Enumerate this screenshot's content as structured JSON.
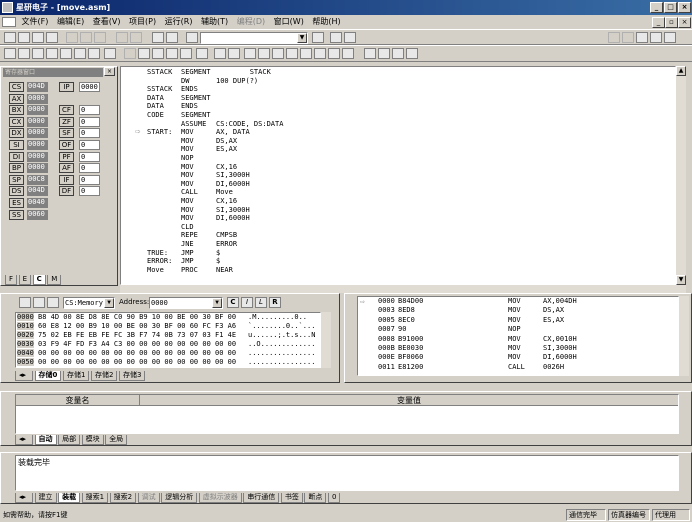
{
  "window": {
    "title": "星研电子 - [move.asm]"
  },
  "menu": {
    "items": [
      "文件(F)",
      "编辑(E)",
      "查看(V)",
      "项目(P)",
      "运行(R)",
      "辅助(T)",
      "编程(D)",
      "窗口(W)",
      "帮助(H)"
    ]
  },
  "toolbar": {
    "target_select": "",
    "memory_select": "CS:Memory",
    "address_label": "Address:",
    "address_value": "0000",
    "btn_c": "C",
    "btn_i": "I",
    "btn_l": "L",
    "btn_r": "R"
  },
  "registers": {
    "title": "寄存器窗口",
    "rows": [
      {
        "l": "CS",
        "v": "004D",
        "l2": "IP",
        "v2": "0000"
      },
      {
        "l": "AX",
        "v": "0000"
      },
      {
        "l": "BX",
        "v": "0000",
        "l2": "CF",
        "v2": "0"
      },
      {
        "l": "CX",
        "v": "0000",
        "l2": "ZF",
        "v2": "0"
      },
      {
        "l": "DX",
        "v": "0000",
        "l2": "SF",
        "v2": "0"
      },
      {
        "l": "SI",
        "v": "0000",
        "l2": "OF",
        "v2": "0"
      },
      {
        "l": "DI",
        "v": "0000",
        "l2": "PF",
        "v2": "0"
      },
      {
        "l": "BP",
        "v": "0000",
        "l2": "AF",
        "v2": "0"
      },
      {
        "l": "SP",
        "v": "00C8",
        "l2": "IF",
        "v2": "0"
      },
      {
        "l": "DS",
        "v": "004D",
        "l2": "DF",
        "v2": "0"
      },
      {
        "l": "ES",
        "v": "0040"
      },
      {
        "l": "SS",
        "v": "0060"
      }
    ],
    "tabs": [
      "F",
      "E",
      "C",
      "M"
    ]
  },
  "source": {
    "lines": [
      {
        "a": "SSTACK",
        "b": "SEGMENT",
        "c": "        STACK"
      },
      {
        "a": "",
        "b": "DW",
        "c": "100 DUP(?)"
      },
      {
        "a": "SSTACK",
        "b": "ENDS",
        "c": ""
      },
      {
        "a": "DATA",
        "b": "SEGMENT",
        "c": ""
      },
      {
        "a": "DATA",
        "b": "ENDS",
        "c": ""
      },
      {
        "a": "CODE",
        "b": "SEGMENT",
        "c": ""
      },
      {
        "a": "",
        "b": "ASSUME",
        "c": "CS:CODE, DS:DATA"
      },
      {
        "a": "START:",
        "b": "MOV",
        "c": "AX, DATA"
      },
      {
        "a": "",
        "b": "MOV",
        "c": "DS,AX"
      },
      {
        "a": "",
        "b": "MOV",
        "c": "ES,AX"
      },
      {
        "a": "",
        "b": "NOP",
        "c": ""
      },
      {
        "a": "",
        "b": "MOV",
        "c": "CX,16"
      },
      {
        "a": "",
        "b": "MOV",
        "c": "SI,3000H"
      },
      {
        "a": "",
        "b": "MOV",
        "c": "DI,6000H"
      },
      {
        "a": "",
        "b": "CALL",
        "c": "Move"
      },
      {
        "a": "",
        "b": "MOV",
        "c": "CX,16"
      },
      {
        "a": "",
        "b": "MOV",
        "c": "SI,3000H"
      },
      {
        "a": "",
        "b": "MOV",
        "c": "DI,6000H"
      },
      {
        "a": "",
        "b": "CLD",
        "c": ""
      },
      {
        "a": "",
        "b": "REPE",
        "c": "CMPSB"
      },
      {
        "a": "",
        "b": "JNE",
        "c": "ERROR"
      },
      {
        "a": "TRUE:",
        "b": "JMP",
        "c": "$"
      },
      {
        "a": "ERROR:",
        "b": "JMP",
        "c": "$"
      },
      {
        "a": "Move",
        "b": "PROC",
        "c": "NEAR"
      }
    ]
  },
  "memory": {
    "rows": [
      {
        "addr": "0000",
        "hex": "B8 4D 00 8E D8 8E C0 90 B9 10 00 BE 00 30 BF 00",
        "asc": ".M.........0.."
      },
      {
        "addr": "0010",
        "hex": "60 E8 12 00 B9 10 00 BE 00 30 BF 00 60 FC F3 A6",
        "asc": "`........0..`..."
      },
      {
        "addr": "0020",
        "hex": "75 02 EB FE EB FE FC 3B F7 74 0B 73 07 03 F1 4E",
        "asc": "u......;.t.s...N"
      },
      {
        "addr": "0030",
        "hex": "03 F9 4F FD F3 A4 C3 00 00 00 00 00 00 00 00 00",
        "asc": "..O............."
      },
      {
        "addr": "0040",
        "hex": "00 00 00 00 00 00 00 00 00 00 00 00 00 00 00 00",
        "asc": "................"
      },
      {
        "addr": "0050",
        "hex": "00 00 00 00 00 00 00 00 00 00 00 00 00 00 00 00",
        "asc": "................"
      }
    ],
    "tabs": [
      "存储0",
      "存储1",
      "存储2",
      "存储3"
    ]
  },
  "disasm": {
    "rows": [
      {
        "addr": "0000",
        "code": "B84D00",
        "op": "MOV",
        "arg": "AX,004DH"
      },
      {
        "addr": "0003",
        "code": "8ED8",
        "op": "MOV",
        "arg": "DS,AX"
      },
      {
        "addr": "0005",
        "code": "8EC0",
        "op": "MOV",
        "arg": "ES,AX"
      },
      {
        "addr": "0007",
        "code": "90",
        "op": "NOP",
        "arg": ""
      },
      {
        "addr": "0008",
        "code": "B91000",
        "op": "MOV",
        "arg": "CX,0010H"
      },
      {
        "addr": "000B",
        "code": "BE0030",
        "op": "MOV",
        "arg": "SI,3000H"
      },
      {
        "addr": "000E",
        "code": "BF0060",
        "op": "MOV",
        "arg": "DI,6000H"
      },
      {
        "addr": "0011",
        "code": "E81200",
        "op": "CALL",
        "arg": "0026H"
      }
    ]
  },
  "watch": {
    "col1": "变量名",
    "col2": "变量值",
    "tabs": [
      "自动",
      "局部",
      "模块",
      "全局"
    ]
  },
  "output": {
    "message": "装载完毕",
    "tabs": [
      "建立",
      "装载",
      "搜索1",
      "搜索2",
      "调试",
      "逻辑分析",
      "虚拟示波器",
      "串行通信",
      "书签",
      "断点",
      "0"
    ]
  },
  "statusbar": {
    "help": "如需帮助，请按F1键",
    "state": "通信完毕",
    "emu": "仿真器编号",
    "mode": "代理用"
  }
}
